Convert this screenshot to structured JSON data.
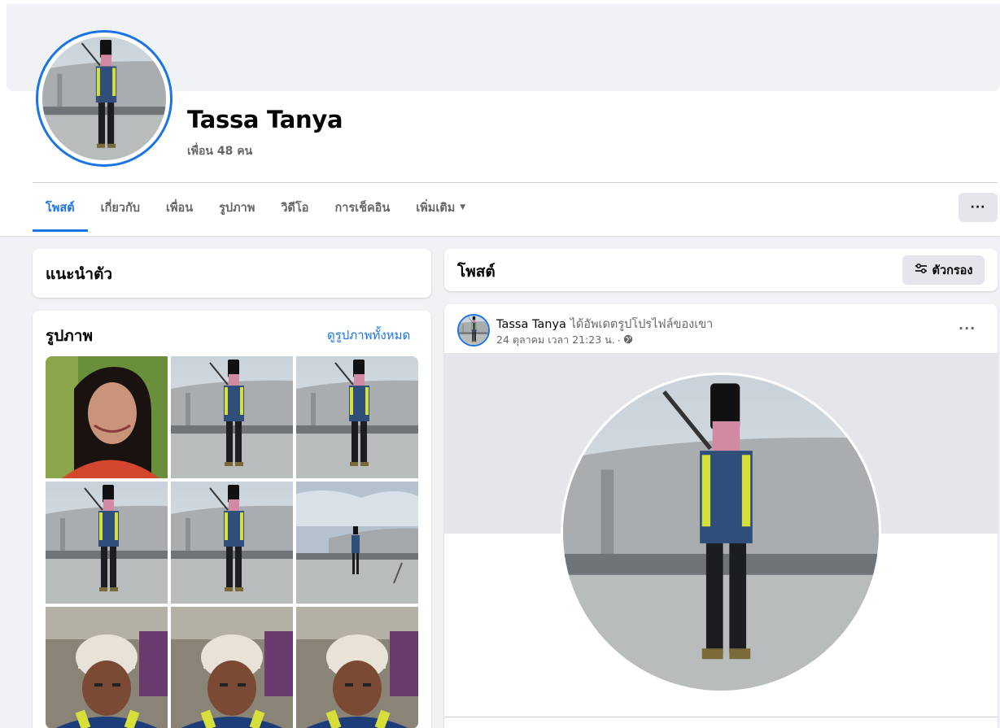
{
  "profile": {
    "name": "Tassa Tanya",
    "friends": "เพื่อน 48 คน"
  },
  "tabs": [
    {
      "label": "โพสต์",
      "active": true
    },
    {
      "label": "เกี่ยวกับ"
    },
    {
      "label": "เพื่อน"
    },
    {
      "label": "รูปภาพ"
    },
    {
      "label": "วิดีโอ"
    },
    {
      "label": "การเช็คอิน"
    },
    {
      "label": "เพิ่มเติม"
    }
  ],
  "more_button": "···",
  "intro": {
    "title": "แนะนำตัว"
  },
  "photos": {
    "title": "รูปภาพ",
    "see_all": "ดูรูปภาพทั้งหมด",
    "items": [
      "woman-selfie",
      "worker",
      "worker",
      "worker",
      "worker",
      "worker-far",
      "man-helmet",
      "man-helmet",
      "man-helmet"
    ]
  },
  "posts_header": {
    "title": "โพสต์",
    "filter_label": "ตัวกรอง",
    "filter_icon": "sliders-icon"
  },
  "post": {
    "author": "Tassa Tanya",
    "action": "ได้อัพเดตรูปโปรไฟล์ของเขา",
    "date": "24 ตุลาคม เวลา 21:23 น.",
    "separator": "·",
    "privacy_icon": "globe-icon",
    "menu": "···"
  },
  "colors": {
    "accent": "#1b74e4",
    "background": "#f0f2f5",
    "secondary_text": "#65676b",
    "button_gray": "#e4e6eb"
  }
}
